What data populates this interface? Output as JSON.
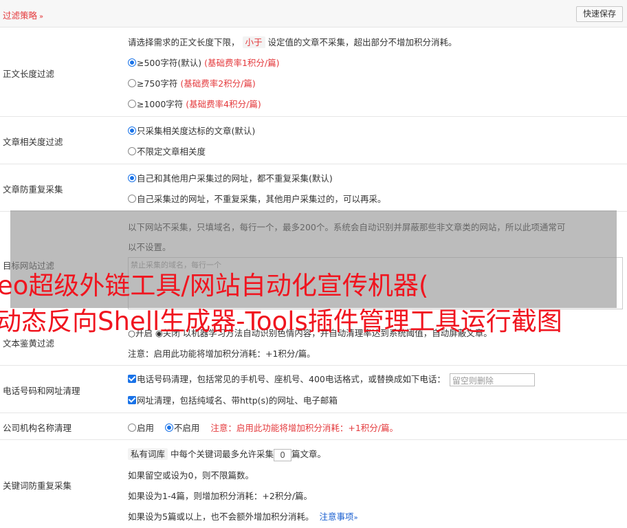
{
  "header": {
    "title": "过滤策略",
    "chevron": "»",
    "save_button": "快速保存"
  },
  "length_filter": {
    "label": "正文长度过滤",
    "desc_before": "请选择需求的正文长度下限，",
    "desc_tag": "小于",
    "desc_after": "设定值的文章不采集，超出部分不增加积分消耗。",
    "options": [
      {
        "text": "≥500字符(默认)",
        "note": "(基础费率1积分/篇)",
        "selected": true
      },
      {
        "text": "≥750字符",
        "note": "(基础费率2积分/篇)",
        "selected": false
      },
      {
        "text": "≥1000字符",
        "note": "(基础费率4积分/篇)",
        "selected": false
      }
    ]
  },
  "relevance_filter": {
    "label": "文章相关度过滤",
    "options": [
      {
        "text": "只采集相关度达标的文章(默认)",
        "selected": true
      },
      {
        "text": "不限定文章相关度",
        "selected": false
      }
    ]
  },
  "dedupe_filter": {
    "label": "文章防重复采集",
    "options": [
      {
        "text": "自己和其他用户采集过的网址，都不重复采集(默认)",
        "selected": true
      },
      {
        "text": "自己采集过的网址，不重复采集，其他用户采集过的，可以再采。",
        "selected": false
      }
    ]
  },
  "site_filter": {
    "label": "目标网站过滤",
    "desc_line1": "以下网站不采集，只填域名，每行一个，最多200个。系统会自动识别并屏蔽那些非文章类的网站，所以此项通常可",
    "desc_line2": "以不设置。",
    "placeholder": "禁止采集的域名，每行一个"
  },
  "porn_filter": {
    "label": "文本鉴黄过滤",
    "options_line": "○开启  ◉关闭  以机器学习方法自动识别色情内容，并自动清理率达到系统阈值，自动屏蔽文章。",
    "notice": "注意：启用此功能将增加积分消耗：+1积分/篇。"
  },
  "contact_filter": {
    "label": "电话号码和网址清理",
    "phone_text": "电话号码清理，包括常见的手机号、座机号、400电话格式，或替换成如下电话：",
    "phone_placeholder": "留空则删除",
    "url_text": "网址清理，包括纯域名、带http(s)的网址、电子邮箱"
  },
  "company_filter": {
    "label": "公司机构名称清理",
    "option_on": "启用",
    "option_off": "不启用",
    "notice": "注意：启用此功能将增加积分消耗：+1积分/篇。"
  },
  "keyword_filter": {
    "label": "关键词防重复采集",
    "tag": "私有词库",
    "line1_before": "中每个关键词最多允许采集",
    "count_value": "0",
    "line1_after": "篇文章。",
    "line2": "如果留空或设为0，则不限篇数。",
    "line3": "如果设为1-4篇，则增加积分消耗：+2积分/篇。",
    "line4": "如果设为5篇或以上，也不会额外增加积分消耗。",
    "link": "注意事项",
    "link_chevron": "»"
  },
  "watermark": {
    "line1": "eo超级外链工具/网站自动化宣传机器(",
    "line2": "动态反向Shell生成器-Tools插件管理工具运行截图"
  }
}
